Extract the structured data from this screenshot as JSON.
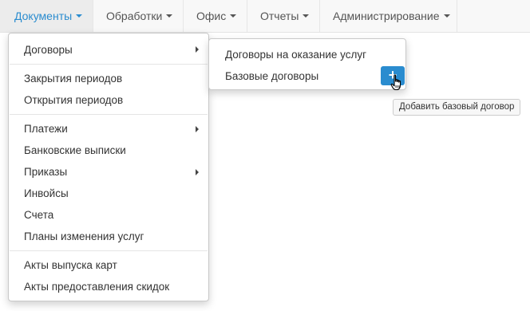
{
  "navbar": {
    "items": [
      {
        "label": "Документы"
      },
      {
        "label": "Обработки"
      },
      {
        "label": "Офис"
      },
      {
        "label": "Отчеты"
      },
      {
        "label": "Администрирование"
      }
    ],
    "active_color": "#2a8ccf"
  },
  "documents_menu": {
    "items": [
      {
        "label": "Договоры"
      },
      {
        "label": "Закрытия периодов"
      },
      {
        "label": "Открытия периодов"
      },
      {
        "label": "Платежи"
      },
      {
        "label": "Банковские выписки"
      },
      {
        "label": "Приказы"
      },
      {
        "label": "Инвойсы"
      },
      {
        "label": "Счета"
      },
      {
        "label": "Планы изменения услуг"
      },
      {
        "label": "Акты выпуска карт"
      },
      {
        "label": "Акты предоставления скидок"
      }
    ]
  },
  "contracts_submenu": {
    "items": [
      {
        "label": "Договоры на оказание услуг"
      },
      {
        "label": "Базовые договоры"
      }
    ],
    "add_button_glyph": "+",
    "add_button_color": "#2a8ccf"
  },
  "tooltip": {
    "text": "Добавить базовый договор"
  },
  "icons": {
    "caret": "caret-down-icon",
    "submenu_arrow": "chevron-right-icon",
    "add": "plus-icon",
    "cursor": "hand-pointer-icon"
  }
}
